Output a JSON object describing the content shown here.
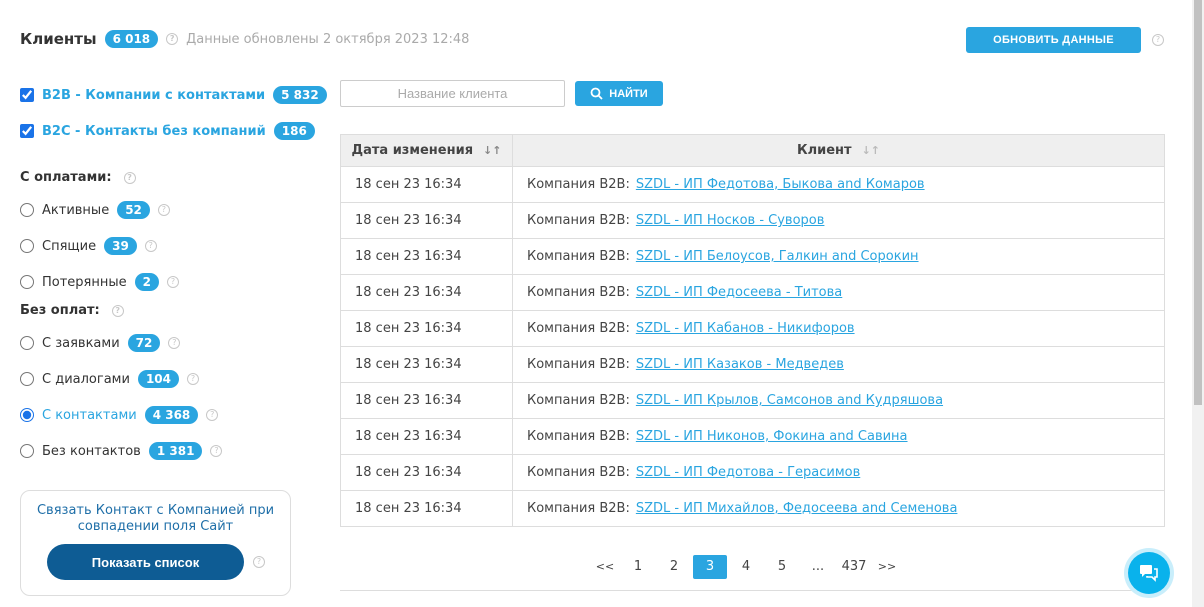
{
  "header": {
    "title": "Клиенты",
    "total": "6 018",
    "updated": "Данные обновлены 2 октября 2023  12:48",
    "refresh_label": "ОБНОВИТЬ ДАННЫЕ"
  },
  "filters": {
    "b2b": {
      "label": "B2B - Компании с контактами",
      "count": "5 832",
      "checked": true
    },
    "b2c": {
      "label": "B2C - Контакты без компаний",
      "count": "186",
      "checked": true
    },
    "paid_title": "С оплатами:",
    "paid": [
      {
        "label": "Активные",
        "count": "52"
      },
      {
        "label": "Спящие",
        "count": "39"
      },
      {
        "label": "Потерянные",
        "count": "2"
      }
    ],
    "unpaid_title": "Без оплат:",
    "unpaid": [
      {
        "label": "С заявками",
        "count": "72"
      },
      {
        "label": "С диалогами",
        "count": "104"
      },
      {
        "label": "С контактами",
        "count": "4 368",
        "selected": true
      },
      {
        "label": "Без контактов",
        "count": "1 381"
      }
    ]
  },
  "link_box": {
    "text": "Связать Контакт с Компанией при совпадении поля Сайт",
    "button": "Показать список"
  },
  "search": {
    "placeholder": "Название клиента",
    "value": "",
    "button": "НАЙТИ"
  },
  "table": {
    "columns": [
      "Дата изменения",
      "Клиент"
    ],
    "rows": [
      {
        "date": "18 сен 23  16:34",
        "type": "Компания  B2B:",
        "name": "SZDL - ИП Федотова, Быкова and Комаров"
      },
      {
        "date": "18 сен 23  16:34",
        "type": "Компания  B2B:",
        "name": "SZDL - ИП Носков - Суворов"
      },
      {
        "date": "18 сен 23  16:34",
        "type": "Компания  B2B:",
        "name": "SZDL - ИП Белоусов, Галкин and Сорокин"
      },
      {
        "date": "18 сен 23  16:34",
        "type": "Компания  B2B:",
        "name": "SZDL - ИП Федосеева - Титова"
      },
      {
        "date": "18 сен 23  16:34",
        "type": "Компания  B2B:",
        "name": "SZDL - ИП Кабанов - Никифоров"
      },
      {
        "date": "18 сен 23  16:34",
        "type": "Компания  B2B:",
        "name": "SZDL - ИП Казаков - Медведев"
      },
      {
        "date": "18 сен 23  16:34",
        "type": "Компания  B2B:",
        "name": "SZDL - ИП Крылов, Самсонов and Кудряшова"
      },
      {
        "date": "18 сен 23  16:34",
        "type": "Компания  B2B:",
        "name": "SZDL - ИП Никонов, Фокина and Савина"
      },
      {
        "date": "18 сен 23  16:34",
        "type": "Компания  B2B:",
        "name": "SZDL - ИП Федотова - Герасимов"
      },
      {
        "date": "18 сен 23  16:34",
        "type": "Компания  B2B:",
        "name": "SZDL - ИП Михайлов, Федосеева and Семенова"
      }
    ]
  },
  "pagination": {
    "items": [
      "<<",
      "1",
      "2",
      "3",
      "4",
      "5",
      "...",
      "437",
      ">>"
    ],
    "current": "3"
  },
  "colors": {
    "accent": "#2aa5e0",
    "dark_button": "#0e5c94",
    "chat": "#09b2ec"
  }
}
